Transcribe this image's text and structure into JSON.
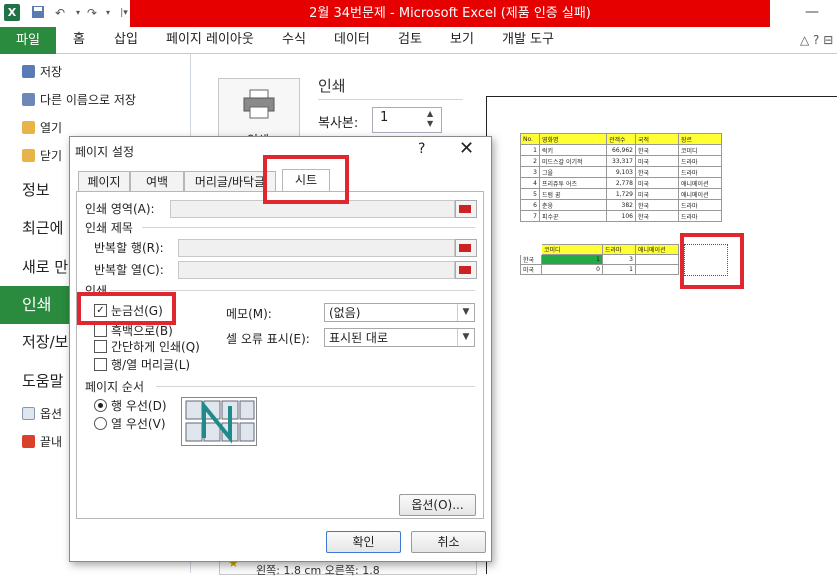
{
  "window": {
    "title": "2월 34번문제 - Microsoft Excel (제품 인증 실패)",
    "minimize": "—"
  },
  "quick_access": {
    "icons": [
      "excel-icon",
      "save-icon",
      "undo-icon",
      "redo-icon"
    ]
  },
  "ribbon": {
    "file_tab": "파일",
    "tabs": [
      "홈",
      "삽입",
      "페이지 레이아웃",
      "수식",
      "데이터",
      "검토",
      "보기",
      "개발 도구"
    ],
    "controls": "△ ? ⊟"
  },
  "backstage": {
    "small_top": [
      "저장",
      "다른 이름으로 저장",
      "열기",
      "닫기"
    ],
    "big": [
      "정보",
      "최근에",
      "새로 만",
      "인쇄",
      "저장/보",
      "도움말"
    ],
    "small_bottom": [
      "옵션",
      "끝내"
    ]
  },
  "print_panel": {
    "button_label": "인쇄",
    "title": "인쇄",
    "copies_label": "복사본:",
    "copies_value": "1",
    "bottom_text": "왼쪽: 1.8 cm    오른쪽: 1.8"
  },
  "preview": {
    "headers": [
      "No.",
      "영화명",
      "관객수",
      "국적",
      "장르"
    ],
    "rows": [
      [
        "1",
        "럭키",
        "66,962",
        "한국",
        "코미디"
      ],
      [
        "2",
        "미드스갈 이기적",
        "33,317",
        "미국",
        "드라마"
      ],
      [
        "3",
        "그을",
        "9,103",
        "한국",
        "드라마"
      ],
      [
        "4",
        "프리쥬투 어즈",
        "2,778",
        "미국",
        "애니메이션"
      ],
      [
        "5",
        "드럼 꿈",
        "1,729",
        "미국",
        "애니메이션"
      ],
      [
        "6",
        "춘웅",
        "382",
        "한국",
        "드라마"
      ],
      [
        "7",
        "피수꾼",
        "106",
        "한국",
        "드라마"
      ]
    ],
    "summary_headers": [
      "",
      "코미디",
      "드라마",
      "애니메이션"
    ],
    "summary_rows": [
      [
        "한국",
        "1",
        "3",
        ""
      ],
      [
        "미국",
        "0",
        "1",
        ""
      ]
    ]
  },
  "dialog": {
    "title": "페이지 설정",
    "help": "?",
    "close": "✕",
    "tabs": [
      "페이지",
      "여백",
      "머리글/바닥글",
      "시트"
    ],
    "print_area_label": "인쇄 영역(A):",
    "print_titles_label": "인쇄 제목",
    "repeat_rows_label": "반복할 행(R):",
    "repeat_cols_label": "반복할 열(C):",
    "print_section_label": "인쇄",
    "checkboxes": [
      {
        "label": "눈금선(G)",
        "checked": true
      },
      {
        "label": "흑백으로(B)",
        "checked": false
      },
      {
        "label": "간단하게 인쇄(Q)",
        "checked": false
      },
      {
        "label": "행/열 머리글(L)",
        "checked": false
      }
    ],
    "memo_label": "메모(M):",
    "memo_value": "(없음)",
    "cell_error_label": "셀 오류 표시(E):",
    "cell_error_value": "표시된 대로",
    "page_order_label": "페이지 순서",
    "radio_row": "행 우선(D)",
    "radio_col": "열 우선(V)",
    "selected_order": "row",
    "options_button": "옵션(O)...",
    "ok_button": "확인",
    "cancel_button": "취소"
  },
  "colors": {
    "title_red": "#e60000",
    "file_green": "#2a8a3e",
    "highlight_red": "#e0262f",
    "yellow": "#ffff33",
    "cell_green": "#22aa44"
  }
}
